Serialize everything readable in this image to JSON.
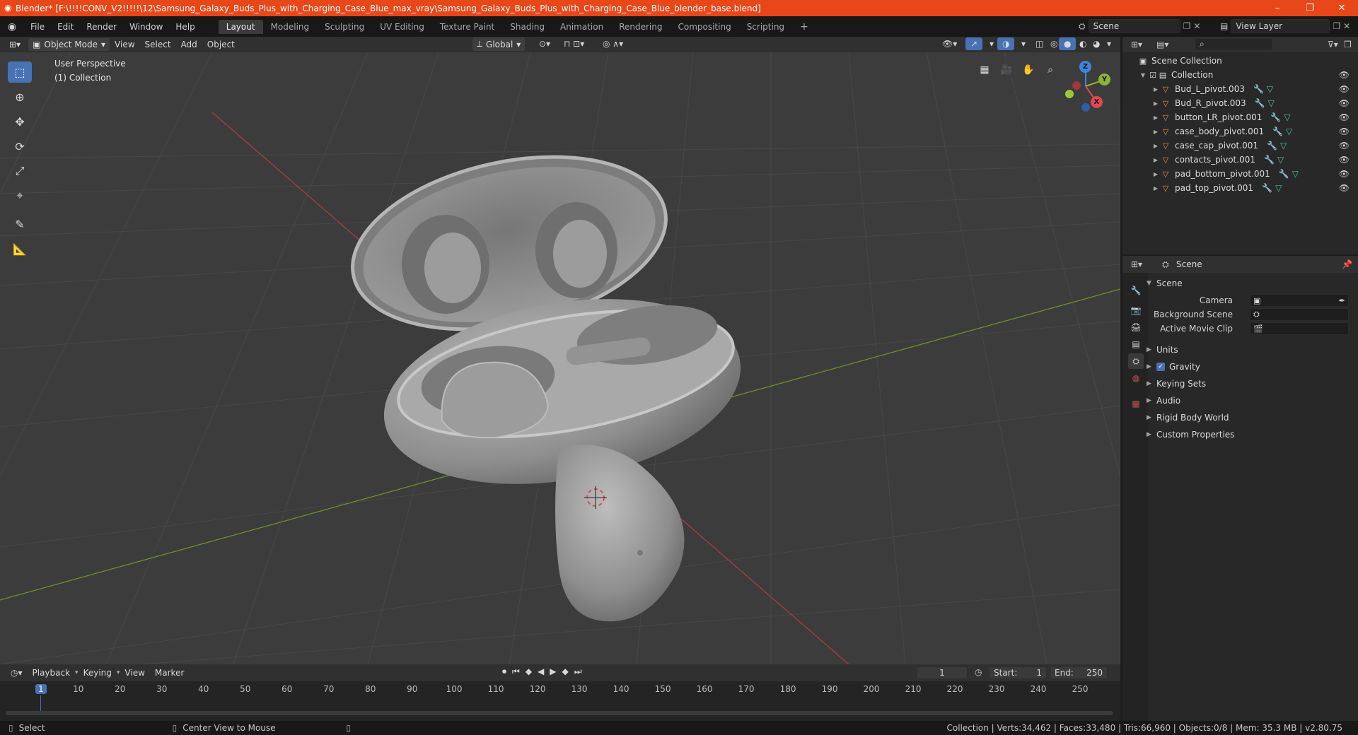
{
  "title": "Blender* [F:\\!!!!CONV_V2!!!!!\\12\\Samsung_Galaxy_Buds_Plus_with_Charging_Case_Blue_max_vray\\Samsung_Galaxy_Buds_Plus_with_Charging_Case_Blue_blender_base.blend]",
  "window_controls": {
    "minimize": "–",
    "maximize": "❐",
    "close": "✕"
  },
  "menu": [
    "File",
    "Edit",
    "Render",
    "Window",
    "Help"
  ],
  "workspaces": [
    "Layout",
    "Modeling",
    "Sculpting",
    "UV Editing",
    "Texture Paint",
    "Shading",
    "Animation",
    "Rendering",
    "Compositing",
    "Scripting"
  ],
  "workspace_add": "+",
  "scene_field": "Scene",
  "view_layer_field": "View Layer",
  "viewport_header": {
    "mode": "Object Mode",
    "menus": [
      "View",
      "Select",
      "Add",
      "Object"
    ],
    "transform_orientation": "Global"
  },
  "viewport": {
    "perspective": "User Perspective",
    "collection": "(1) Collection",
    "gizmo_axes": {
      "x": "X",
      "y": "Y",
      "z": "Z"
    }
  },
  "tools": [
    "select-box",
    "cursor",
    "move",
    "rotate",
    "scale",
    "transform",
    "annotate",
    "measure"
  ],
  "timeline_header": {
    "menus": [
      "Playback",
      "Keying",
      "View",
      "Marker"
    ],
    "current_frame": "1",
    "start_label": "Start:",
    "start_value": "1",
    "end_label": "End:",
    "end_value": "250"
  },
  "timeline_ticks": [
    "1",
    "10",
    "20",
    "30",
    "40",
    "50",
    "60",
    "70",
    "80",
    "90",
    "100",
    "110",
    "120",
    "130",
    "140",
    "150",
    "160",
    "170",
    "180",
    "190",
    "200",
    "210",
    "220",
    "230",
    "240",
    "250"
  ],
  "outliner": {
    "root": "Scene Collection",
    "collection": "Collection",
    "items": [
      "Bud_L_pivot.003",
      "Bud_R_pivot.003",
      "button_LR_pivot.001",
      "case_body_pivot.001",
      "case_cap_pivot.001",
      "contacts_pivot.001",
      "pad_bottom_pivot.001",
      "pad_top_pivot.001"
    ]
  },
  "properties": {
    "context": "Scene",
    "panel": "Scene",
    "camera_label": "Camera",
    "background_scene_label": "Background Scene",
    "active_movie_clip_label": "Active Movie Clip",
    "sections": [
      "Units",
      "Gravity",
      "Keying Sets",
      "Audio",
      "Rigid Body World",
      "Custom Properties"
    ]
  },
  "status": {
    "left": "Select",
    "middle": "Center View to Mouse",
    "right": "Collection | Verts:34,462 | Faces:33,480 | Tris:66,960 | Objects:0/8 | Mem: 35.3 MB | v2.80.75"
  },
  "colors": {
    "titlebar": "#e8471a",
    "accent": "#4772b3",
    "x_axis": "#e5464d",
    "y_axis": "#8ab534",
    "z_axis": "#3d86e0",
    "viewport_bg": "#3c3c3c"
  }
}
